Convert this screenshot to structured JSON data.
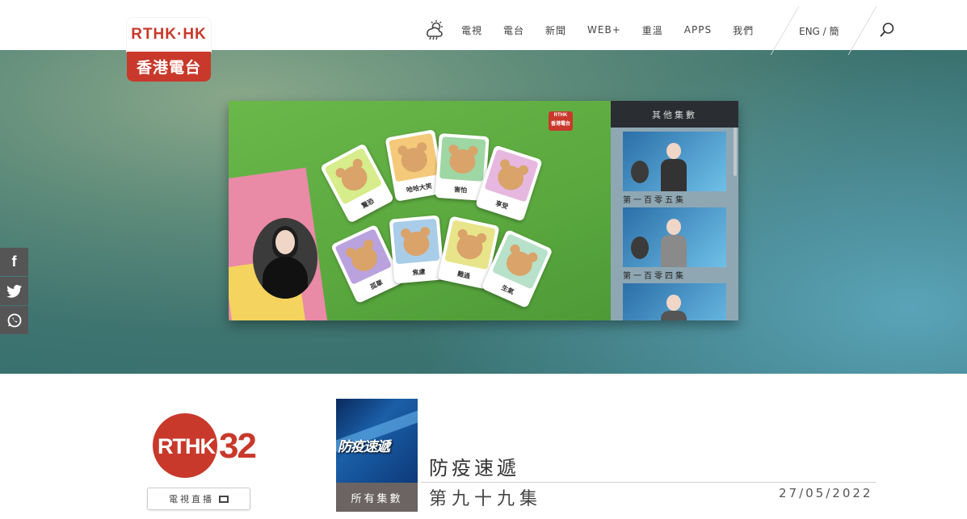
{
  "header": {
    "logo_en": "RTHK·HK",
    "logo_zh": "香港電台",
    "nav": [
      "電視",
      "電台",
      "新聞",
      "WEB+",
      "重溫",
      "APPS",
      "我們"
    ],
    "lang": "ENG / 簡"
  },
  "player": {
    "video_logo_en": "RTHK",
    "video_logo_zh": "香港電台",
    "cards": [
      "驚恐",
      "哈哈大笑",
      "害怕",
      "享受",
      "孤單",
      "焦慮",
      "難過",
      "生氣"
    ],
    "episodes_heading": "其他集數",
    "episodes": [
      "第一百零五集",
      "第一百零四集"
    ]
  },
  "social": [
    "f",
    "t",
    "w"
  ],
  "channel": {
    "logo_text": "RTHK",
    "number": "32",
    "live_label": "電視直播"
  },
  "programme": {
    "thumb_text": "防疫速遞",
    "all_episodes": "所有集數",
    "title": "防疫速遞",
    "episode": "第九十九集",
    "date": "27/05/2022"
  }
}
